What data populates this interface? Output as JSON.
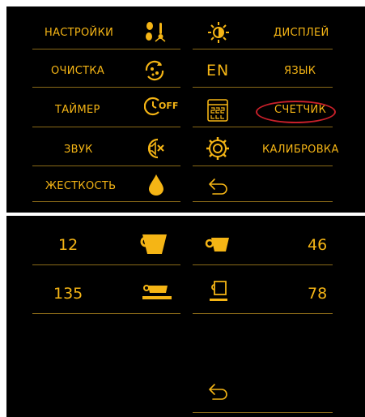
{
  "menu": {
    "items": [
      {
        "id": "settings",
        "label": "НАСТРОЙКИ",
        "icon": "settings-bean-thermometer-icon"
      },
      {
        "id": "display",
        "label": "ДИСПЛЕЙ",
        "icon": "brightness-icon"
      },
      {
        "id": "cleaning",
        "label": "ОЧИСТКА",
        "icon": "cleaning-cycle-icon"
      },
      {
        "id": "language",
        "label": "ЯЗЫК",
        "icon": "language-icon",
        "icon_text": "EN"
      },
      {
        "id": "timer",
        "label": "ТАЙМЕР",
        "icon": "timer-off-icon",
        "icon_text": "OFF"
      },
      {
        "id": "counter",
        "label": "СЧЕТЧИК",
        "icon": "counter-icon",
        "highlighted": true
      },
      {
        "id": "sound",
        "label": "ЗВУК",
        "icon": "sound-mute-icon"
      },
      {
        "id": "calibration",
        "label": "КАЛИБРОВКА",
        "icon": "grinder-calibration-icon"
      },
      {
        "id": "hardness",
        "label": "ЖЕСТКОСТЬ",
        "icon": "water-drop-icon"
      }
    ],
    "back_icon": "back-arrow-icon"
  },
  "counter": {
    "items": [
      {
        "id": "large-cup",
        "value": "12",
        "icon": "large-cup-icon"
      },
      {
        "id": "espresso-cup",
        "value": "46",
        "icon": "espresso-cup-icon"
      },
      {
        "id": "cappuccino-cup",
        "value": "135",
        "icon": "cup-saucer-icon"
      },
      {
        "id": "small-cup",
        "value": "78",
        "icon": "outline-cup-icon"
      }
    ],
    "back_icon": "back-arrow-icon"
  },
  "colors": {
    "accent": "#f5b515",
    "background": "#000000",
    "highlight": "#c8202a"
  }
}
